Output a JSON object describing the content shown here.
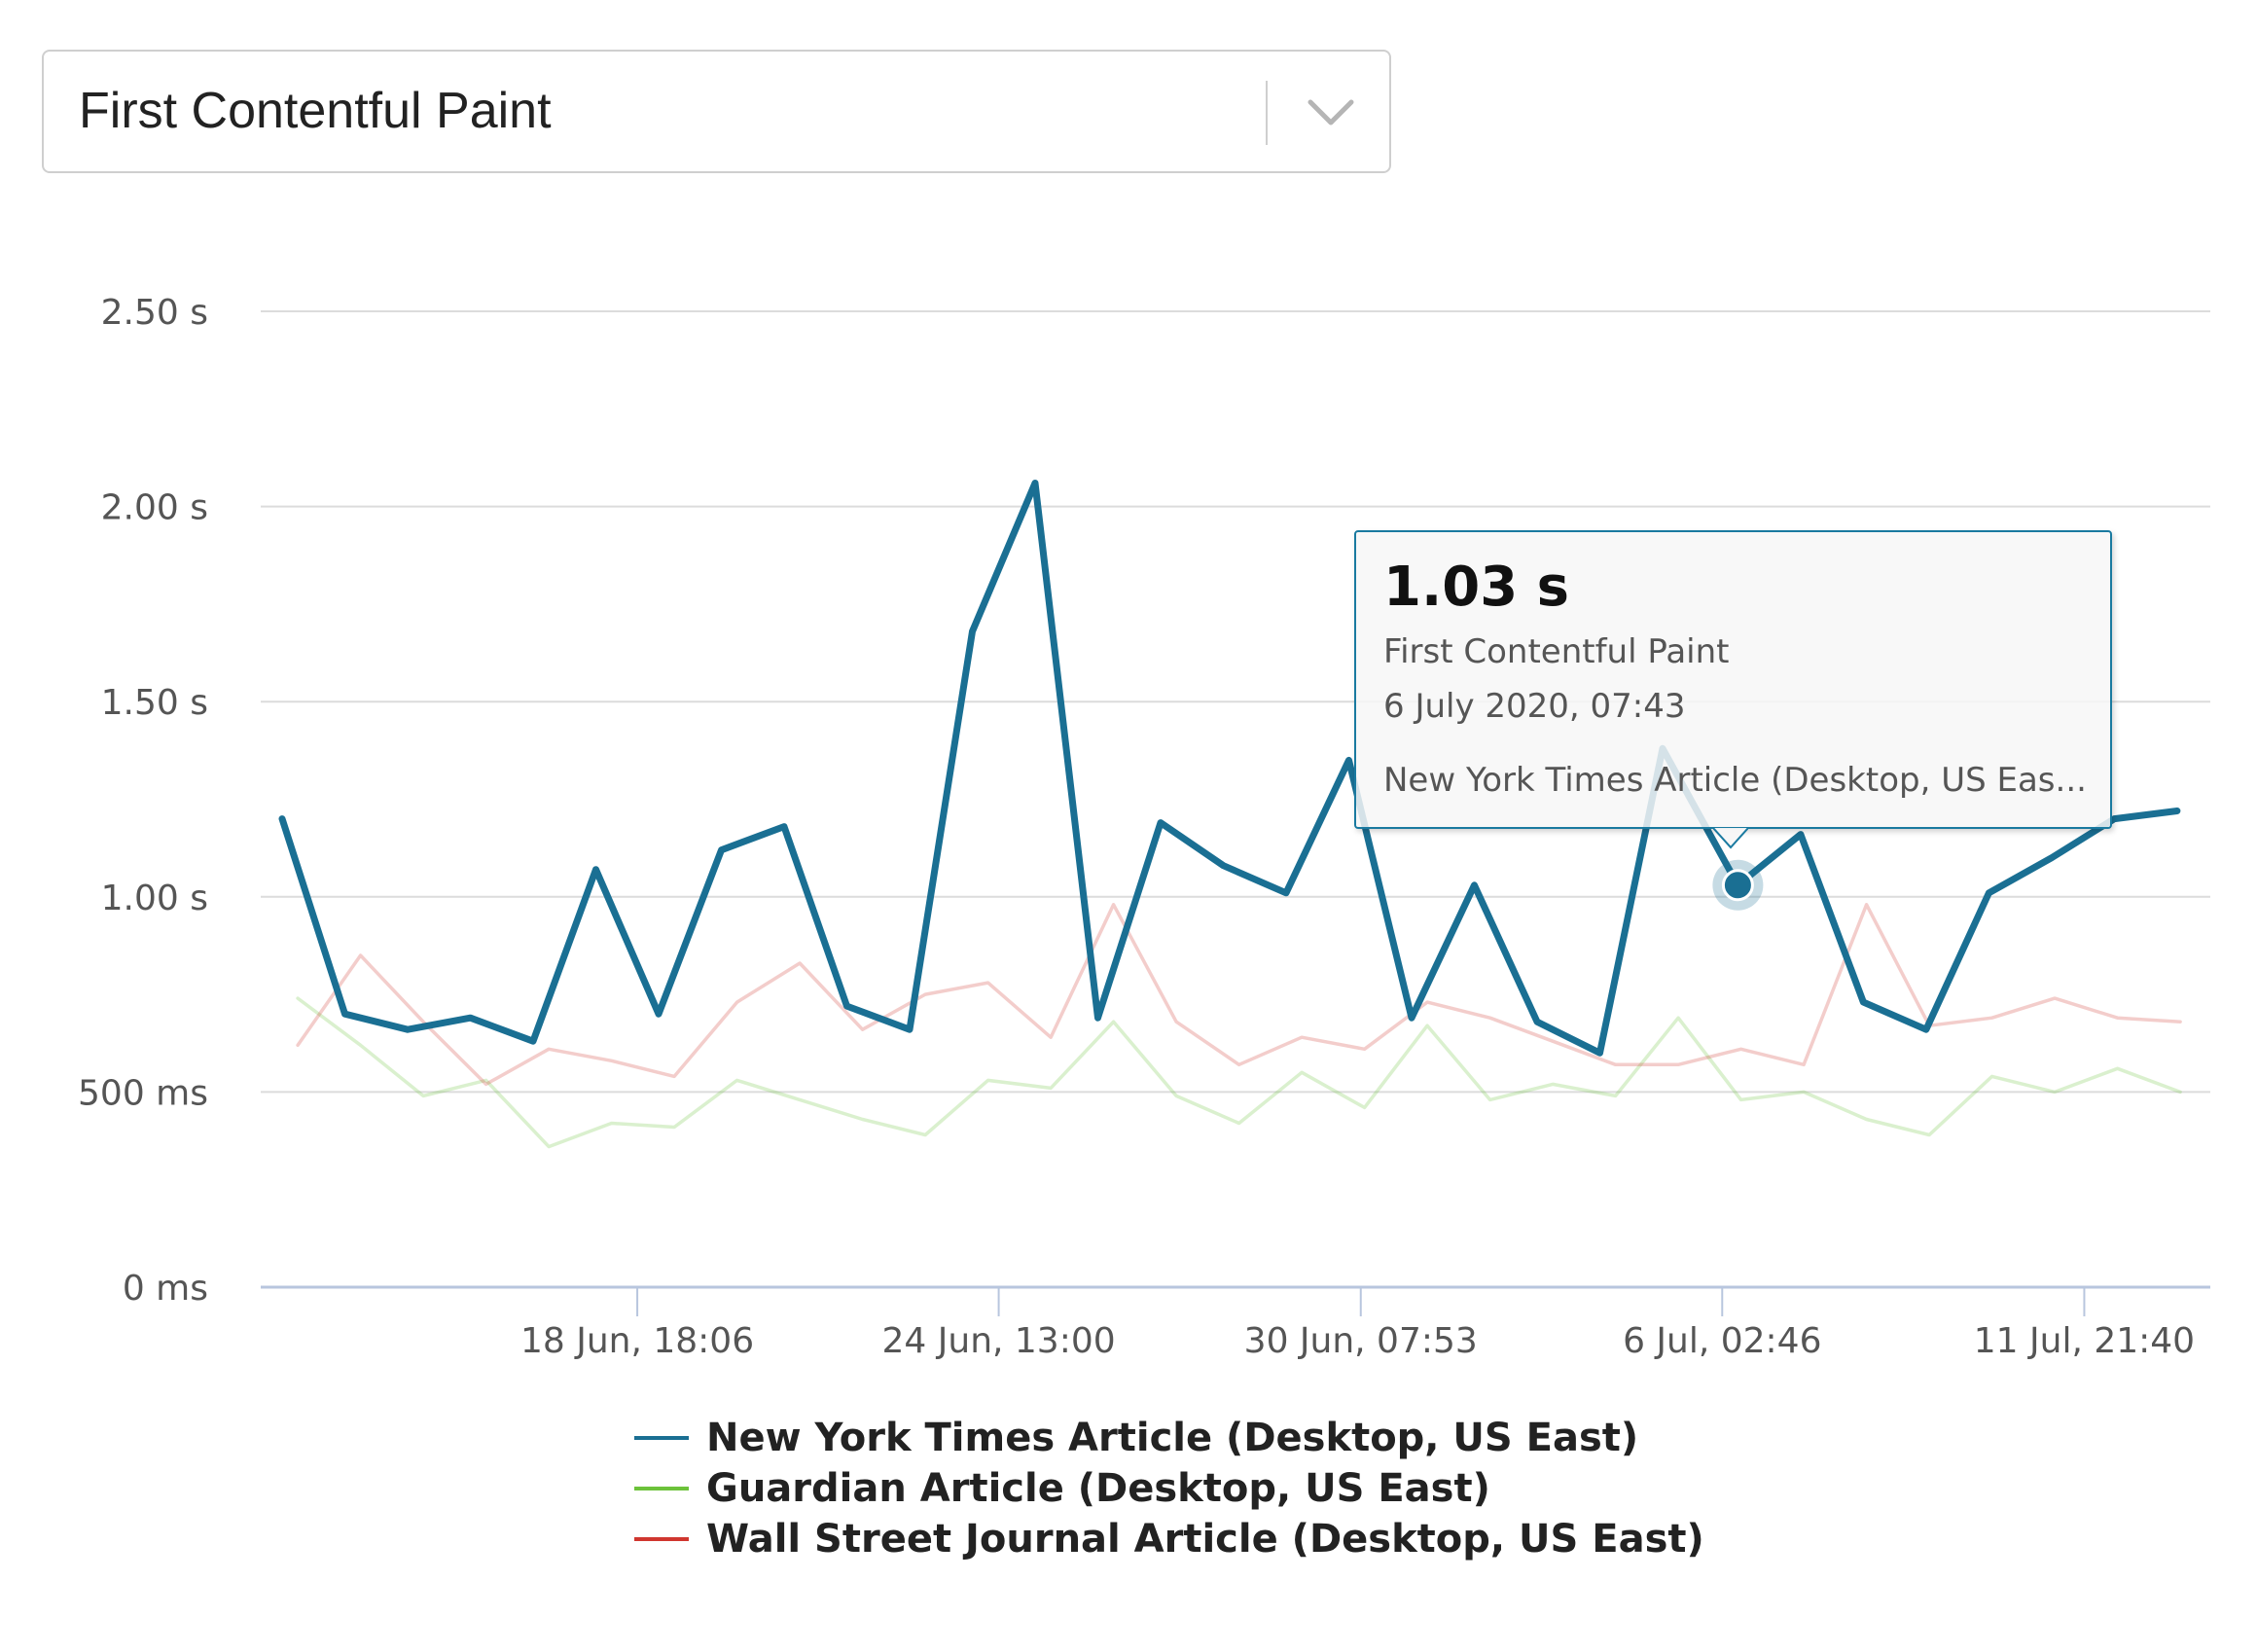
{
  "metric_select": {
    "selected": "First Contentful Paint",
    "chevron_icon": "chevron-down-icon"
  },
  "tooltip": {
    "value": "1.03 s",
    "metric": "First Contentful Paint",
    "date": "6 July 2020, 07:43",
    "series": "New York Times Article (Desktop, US Eas..."
  },
  "chart_data": {
    "type": "line",
    "title": "",
    "xlabel": "",
    "ylabel": "",
    "ylim": [
      0,
      2.5
    ],
    "y_unit": "s",
    "y_ticks": [
      {
        "value": 0,
        "label": "0 ms"
      },
      {
        "value": 0.5,
        "label": "500 ms"
      },
      {
        "value": 1.0,
        "label": "1.00 s"
      },
      {
        "value": 1.5,
        "label": "1.50 s"
      },
      {
        "value": 2.0,
        "label": "2.00 s"
      },
      {
        "value": 2.5,
        "label": "2.50 s"
      }
    ],
    "x_range_index": [
      0,
      30
    ],
    "x_ticks": [
      {
        "index": 5.66,
        "label": "18 Jun, 18:06"
      },
      {
        "index": 11.42,
        "label": "24 Jun, 13:00"
      },
      {
        "index": 17.19,
        "label": "30 Jun, 07:53"
      },
      {
        "index": 22.95,
        "label": "6 Jul, 02:46"
      },
      {
        "index": 28.72,
        "label": "11 Jul, 21:40"
      }
    ],
    "grid": true,
    "legend_position": "bottom-center",
    "highlighted_point": {
      "series": 0,
      "index": 23.2,
      "value": 1.03
    },
    "series": [
      {
        "name": "New York Times Article (Desktop, US East)",
        "color": "#1a6f93",
        "emphasis": "highlighted",
        "points": [
          [
            0,
            1.2
          ],
          [
            1,
            0.7
          ],
          [
            2,
            0.66
          ],
          [
            3,
            0.69
          ],
          [
            4,
            0.63
          ],
          [
            5,
            1.07
          ],
          [
            6,
            0.7
          ],
          [
            7,
            1.12
          ],
          [
            8,
            1.18
          ],
          [
            9,
            0.72
          ],
          [
            10,
            0.66
          ],
          [
            11,
            1.68
          ],
          [
            12,
            2.06
          ],
          [
            13,
            0.69
          ],
          [
            14,
            1.19
          ],
          [
            15,
            1.08
          ],
          [
            16,
            1.01
          ],
          [
            17,
            1.35
          ],
          [
            18,
            0.69
          ],
          [
            19,
            1.03
          ],
          [
            20,
            0.68
          ],
          [
            21,
            0.6
          ],
          [
            22,
            1.38
          ],
          [
            23.2,
            1.03
          ],
          [
            24.2,
            1.16
          ],
          [
            25.2,
            0.73
          ],
          [
            26.2,
            0.66
          ],
          [
            27.2,
            1.01
          ],
          [
            28.2,
            1.1
          ],
          [
            29.2,
            1.2
          ],
          [
            30.2,
            1.22
          ]
        ]
      },
      {
        "name": "Guardian Article (Desktop, US East)",
        "color": "#6cc23a",
        "emphasis": "faded",
        "points": [
          [
            0.25,
            0.74
          ],
          [
            1.25,
            0.62
          ],
          [
            2.25,
            0.49
          ],
          [
            3.25,
            0.53
          ],
          [
            4.25,
            0.36
          ],
          [
            5.25,
            0.42
          ],
          [
            6.25,
            0.41
          ],
          [
            7.25,
            0.53
          ],
          [
            8.25,
            0.48
          ],
          [
            9.25,
            0.43
          ],
          [
            10.25,
            0.39
          ],
          [
            11.25,
            0.53
          ],
          [
            12.25,
            0.51
          ],
          [
            13.25,
            0.68
          ],
          [
            14.25,
            0.49
          ],
          [
            15.25,
            0.42
          ],
          [
            16.25,
            0.55
          ],
          [
            17.25,
            0.46
          ],
          [
            18.25,
            0.67
          ],
          [
            19.25,
            0.48
          ],
          [
            20.25,
            0.52
          ],
          [
            21.25,
            0.49
          ],
          [
            22.25,
            0.69
          ],
          [
            23.25,
            0.48
          ],
          [
            24.25,
            0.5
          ],
          [
            25.25,
            0.43
          ],
          [
            26.25,
            0.39
          ],
          [
            27.25,
            0.54
          ],
          [
            28.25,
            0.5
          ],
          [
            29.25,
            0.56
          ],
          [
            30.25,
            0.5
          ]
        ]
      },
      {
        "name": "Wall Street Journal Article (Desktop, US East)",
        "color": "#d0362f",
        "emphasis": "faded",
        "points": [
          [
            0.25,
            0.62
          ],
          [
            1.25,
            0.85
          ],
          [
            2.25,
            0.68
          ],
          [
            3.25,
            0.52
          ],
          [
            4.25,
            0.61
          ],
          [
            5.25,
            0.58
          ],
          [
            6.25,
            0.54
          ],
          [
            7.25,
            0.73
          ],
          [
            8.25,
            0.83
          ],
          [
            9.25,
            0.66
          ],
          [
            10.25,
            0.75
          ],
          [
            11.25,
            0.78
          ],
          [
            12.25,
            0.64
          ],
          [
            13.25,
            0.98
          ],
          [
            14.25,
            0.68
          ],
          [
            15.25,
            0.57
          ],
          [
            16.25,
            0.64
          ],
          [
            17.25,
            0.61
          ],
          [
            18.25,
            0.73
          ],
          [
            19.25,
            0.69
          ],
          [
            20.25,
            0.63
          ],
          [
            21.25,
            0.57
          ],
          [
            22.25,
            0.57
          ],
          [
            23.25,
            0.61
          ],
          [
            24.25,
            0.57
          ],
          [
            25.25,
            0.98
          ],
          [
            26.25,
            0.67
          ],
          [
            27.25,
            0.69
          ],
          [
            28.25,
            0.74
          ],
          [
            29.25,
            0.69
          ],
          [
            30.25,
            0.68
          ]
        ]
      }
    ]
  }
}
